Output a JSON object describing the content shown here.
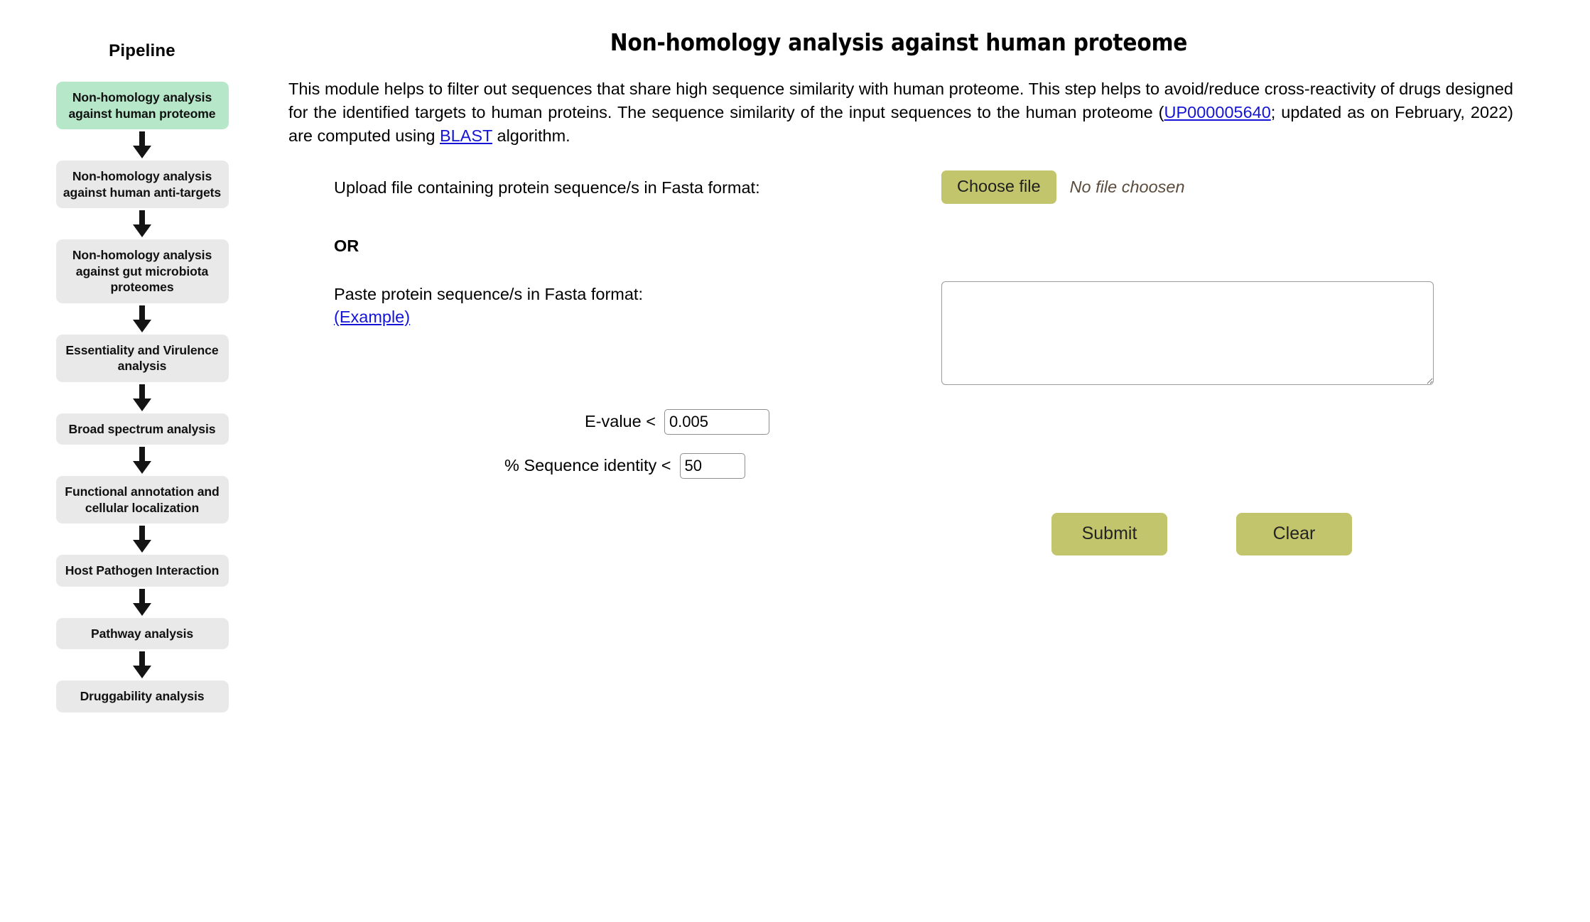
{
  "sidebar": {
    "title": "Pipeline",
    "steps": [
      {
        "label": "Non-homology analysis against human proteome",
        "active": true
      },
      {
        "label": "Non-homology analysis against human anti-targets",
        "active": false
      },
      {
        "label": "Non-homology analysis against gut microbiota proteomes",
        "active": false
      },
      {
        "label": "Essentiality and Virulence analysis",
        "active": false
      },
      {
        "label": "Broad spectrum analysis",
        "active": false
      },
      {
        "label": "Functional annotation and cellular localization",
        "active": false
      },
      {
        "label": "Host Pathogen Interaction",
        "active": false
      },
      {
        "label": "Pathway analysis",
        "active": false
      },
      {
        "label": "Druggability analysis",
        "active": false
      }
    ],
    "arrow_icon": "arrow-down-icon"
  },
  "main": {
    "title": "Non-homology analysis against human proteome",
    "description": {
      "part1": "This module helps to filter out sequences that share high sequence similarity with human proteome. This step helps to avoid/reduce cross-reactivity of drugs designed for the identified targets to human proteins. The sequence similarity of the input sequences to the human proteome (",
      "link_proteome": "UP000005640",
      "part2": "; updated as on February, 2022) are computed using ",
      "link_blast": "BLAST",
      "part3": " algorithm."
    },
    "upload": {
      "label": "Upload file containing protein sequence/s in Fasta format:",
      "choose_file_label": "Choose file",
      "no_file_text": "No file choosen"
    },
    "or_label": "OR",
    "paste": {
      "label": "Paste protein sequence/s in Fasta format:",
      "example_link": "(Example)",
      "textarea_value": "",
      "textarea_placeholder": ""
    },
    "evalue": {
      "label": "E-value <",
      "value": "0.005"
    },
    "identity": {
      "label": "% Sequence identity <",
      "value": "50"
    },
    "buttons": {
      "submit": "Submit",
      "clear": "Clear"
    }
  },
  "colors": {
    "active_step_bg": "#b6e7c9",
    "step_bg": "#e9e9e9",
    "button_bg": "#c2c56c",
    "link": "#1414d6"
  }
}
